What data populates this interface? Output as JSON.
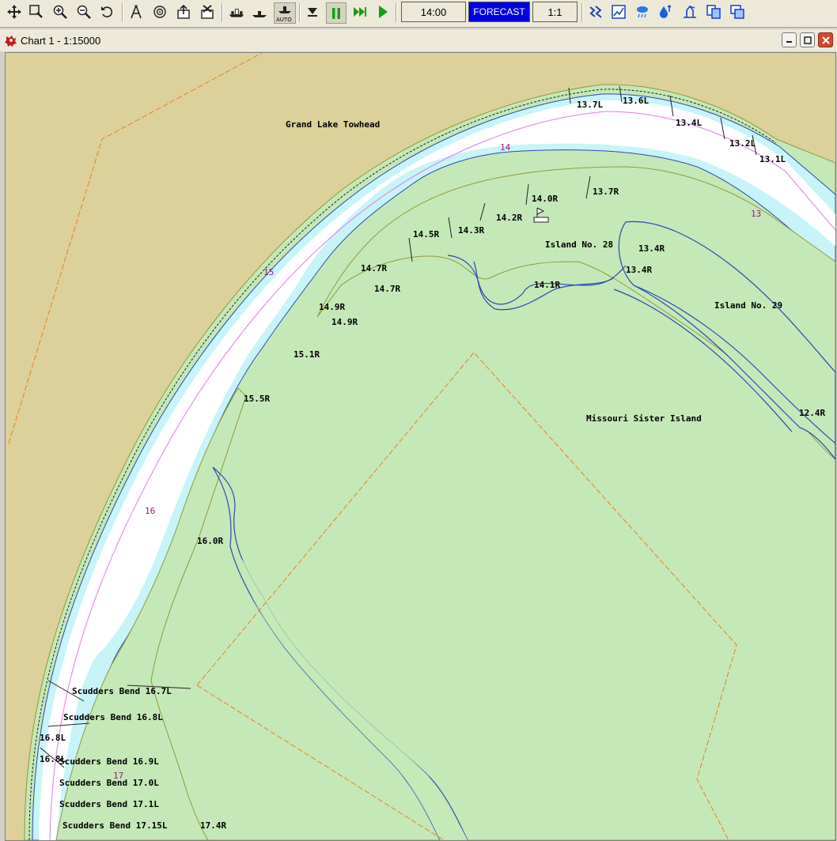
{
  "toolbar": {
    "time": "14:00",
    "forecast": "FORECAST",
    "scale": "1:1",
    "auto_label": "AUTO"
  },
  "window": {
    "title": "Chart 1 - 1:15000"
  },
  "colors": {
    "land": "#dcd19a",
    "vegetation": "#c5e8b8",
    "shallow": "#c8f4f8",
    "channel": "#ffffff",
    "boundary": "#ef7d1a",
    "milepost": "#9a168a"
  },
  "map": {
    "places": {
      "grand_lake_towhead": "Grand Lake Towhead",
      "island_28": "Island No. 28",
      "island_29": "Island No. 29",
      "missouri_sister": "Missouri Sister Island"
    },
    "river_miles": [
      "14",
      "13",
      "15",
      "16",
      "17"
    ],
    "markers": [
      "13.7L",
      "13.6L",
      "13.4L",
      "13.2L",
      "13.1L",
      "14.0R",
      "13.7R",
      "14.2R",
      "14.3R",
      "14.5R",
      "14.7R",
      "14.7R",
      "14.9R",
      "14.9R",
      "15.1R",
      "15.5R",
      "16.0R",
      "13.4R",
      "13.4R",
      "14.1R",
      "12.4R",
      "16.8L",
      "16.8L",
      "17.4R"
    ],
    "bends": [
      "Scudders Bend 16.7L",
      "Scudders Bend 16.8L",
      "Scudders Bend 16.9L",
      "Scudders Bend 17.0L",
      "Scudders Bend 17.1L",
      "Scudders Bend 17.15L"
    ]
  }
}
